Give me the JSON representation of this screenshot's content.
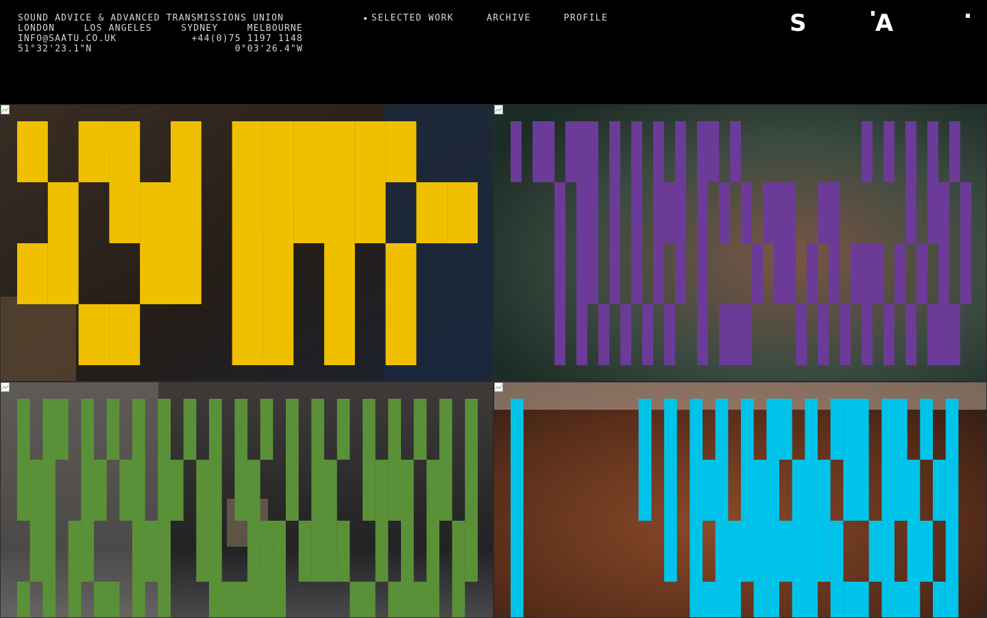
{
  "company": {
    "name": "SOUND ADVICE & ADVANCED TRANSMISSIONS UNION",
    "cities": [
      "LONDON",
      "LOS ANGELES",
      "SYDNEY",
      "MELBOURNE"
    ],
    "email": "INFO@SAATU.CO.UK",
    "phone": "+44(0)75 1197 1148",
    "lat": "51°32'23.1\"N",
    "lon": "0°03'26.4\"W"
  },
  "nav": {
    "selected_work": "SELECTED WORK",
    "archive": "ARCHIVE",
    "profile": "PROFILE",
    "active": "selected_work"
  },
  "logo": {
    "left": "S",
    "right": "A"
  },
  "tiles": [
    {
      "name": "work-tile-1",
      "color": "#f0c000",
      "scene": "workshop-interior",
      "pattern": [
        "101101011111100",
        "010111011111011",
        "110011011010100",
        "001100011010100"
      ]
    },
    {
      "name": "work-tile-2",
      "color": "#6b3b97",
      "scene": "portrait-closeup",
      "pattern": [
        "101101110101010101101000000000001010101010",
        "000010110101011101010101110011000000101101",
        "000010110101010101000010110101011101010101",
        "000010101010101001011100001010101010101110"
      ]
    },
    {
      "name": "work-tile-3",
      "color": "#5a9138",
      "scene": "street-storefront",
      "pattern": [
        "101101010101010101010101010101010101",
        "111001101101101101100101100111101101",
        "011011000111001100111011110010101011",
        "101010110101000111111000001101111010"
      ]
    },
    {
      "name": "work-tile-4",
      "color": "#00c3ea",
      "scene": "figure-closeup",
      "pattern": [
        "100000000010101010101101011101101010",
        "100000000010101110111011101101110110",
        "100000000000101011111111110011011010",
        "100000000000001111011011011101110110"
      ]
    }
  ]
}
